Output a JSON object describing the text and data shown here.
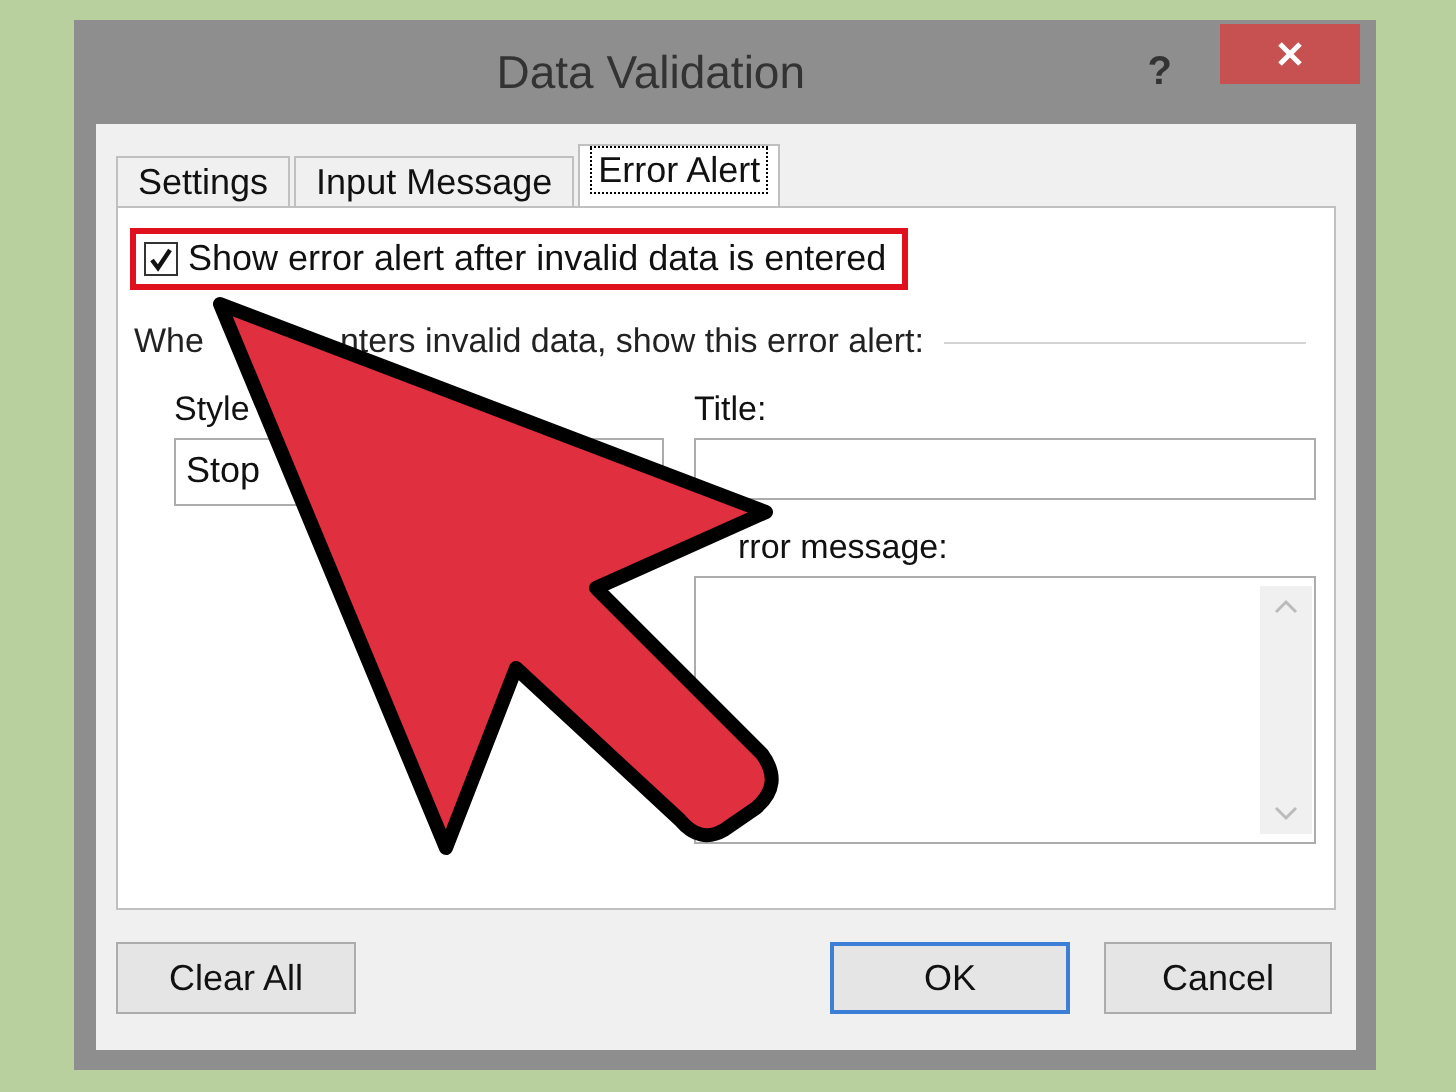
{
  "window": {
    "title": "Data Validation",
    "help": "?"
  },
  "tabs": [
    {
      "label": "Settings",
      "selected": false
    },
    {
      "label": "Input Message",
      "selected": false
    },
    {
      "label": "Error Alert",
      "selected": true
    }
  ],
  "show_alert": {
    "label": "Show error alert after invalid data is entered",
    "checked": true
  },
  "section_label_parts": [
    "Whe",
    "nters invalid data, show this error alert:"
  ],
  "style": {
    "label": "Style",
    "value": "Stop"
  },
  "title_label": "Title:",
  "error_message_label": "rror message:",
  "buttons": [
    {
      "label": "Clear All",
      "kind": "secondary"
    },
    {
      "label": "OK",
      "kind": "default"
    },
    {
      "label": "Cancel",
      "kind": "secondary"
    }
  ]
}
